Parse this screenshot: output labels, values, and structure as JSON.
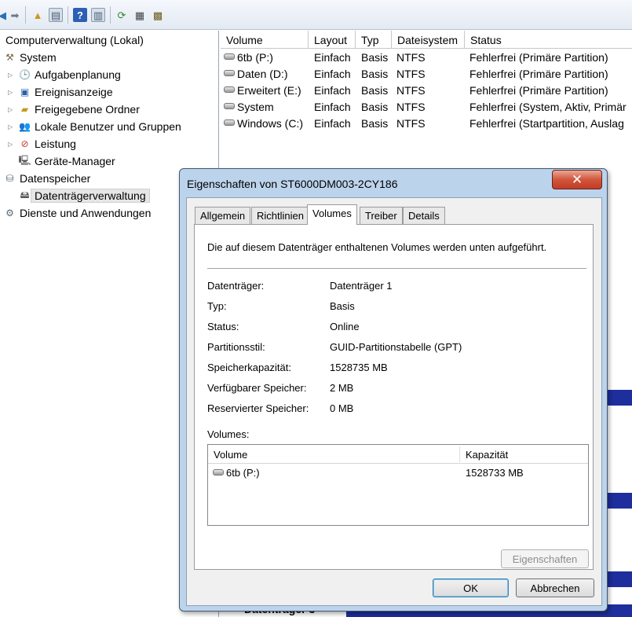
{
  "toolbar": {
    "buttons": [
      "back-icon",
      "forward-icon",
      "up-folder-icon",
      "show-hide-tree-icon",
      "help-icon",
      "show-hide-action-pane-icon",
      "refresh-icon",
      "properties-icon",
      "help-topic-icon"
    ]
  },
  "tree": {
    "root": "Computerverwaltung (Lokal)",
    "system": "System",
    "aufgabenplanung": "Aufgabenplanung",
    "ereignisanzeige": "Ereignisanzeige",
    "freigegebene_ordner": "Freigegebene Ordner",
    "lokale_benutzer": "Lokale Benutzer und Gruppen",
    "leistung": "Leistung",
    "geraete_manager": "Geräte-Manager",
    "datenspeicher": "Datenspeicher",
    "datentraegerverwaltung": "Datenträgerverwaltung",
    "dienste": "Dienste und Anwendungen"
  },
  "volume_list": {
    "columns": [
      "Volume",
      "Layout",
      "Typ",
      "Dateisystem",
      "Status"
    ],
    "rows": [
      {
        "volume": "6tb (P:)",
        "layout": "Einfach",
        "typ": "Basis",
        "fs": "NTFS",
        "status": "Fehlerfrei (Primäre Partition)"
      },
      {
        "volume": "Daten (D:)",
        "layout": "Einfach",
        "typ": "Basis",
        "fs": "NTFS",
        "status": "Fehlerfrei (Primäre Partition)"
      },
      {
        "volume": "Erweitert (E:)",
        "layout": "Einfach",
        "typ": "Basis",
        "fs": "NTFS",
        "status": "Fehlerfrei (Primäre Partition)"
      },
      {
        "volume": "System",
        "layout": "Einfach",
        "typ": "Basis",
        "fs": "NTFS",
        "status": "Fehlerfrei (System, Aktiv, Primär"
      },
      {
        "volume": "Windows (C:)",
        "layout": "Einfach",
        "typ": "Basis",
        "fs": "NTFS",
        "status": "Fehlerfrei (Startpartition, Auslag"
      }
    ],
    "bottom_label": "Datenträger 3"
  },
  "dialog": {
    "title": "Eigenschaften von ST6000DM003-2CY186",
    "close": "✕",
    "tabs": [
      "Allgemein",
      "Richtlinien",
      "Volumes",
      "Treiber",
      "Details"
    ],
    "active_tab": "Volumes",
    "description": "Die auf diesem Datenträger enthaltenen Volumes werden unten aufgeführt.",
    "properties": [
      {
        "label": "Datenträger:",
        "value": "Datenträger 1"
      },
      {
        "label": "Typ:",
        "value": "Basis"
      },
      {
        "label": "Status:",
        "value": "Online"
      },
      {
        "label": "Partitionsstil:",
        "value": "GUID-Partitionstabelle (GPT)"
      },
      {
        "label": "Speicherkapazität:",
        "value": "1528735 MB"
      },
      {
        "label": "Verfügbarer Speicher:",
        "value": "2 MB"
      },
      {
        "label": "Reservierter Speicher:",
        "value": "0 MB"
      }
    ],
    "volumes_label": "Volumes:",
    "volumes_table": {
      "columns": [
        "Volume",
        "Kapazität"
      ],
      "rows": [
        {
          "volume": "6tb (P:)",
          "capacity": "1528733 MB"
        }
      ]
    },
    "eigenschaften_button": "Eigenschaften",
    "ok_button": "OK",
    "abbrechen_button": "Abbrechen"
  }
}
